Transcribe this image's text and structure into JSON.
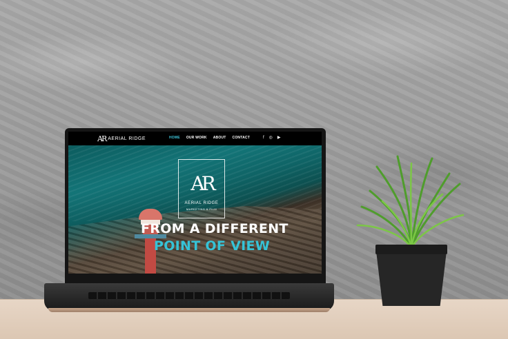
{
  "site": {
    "logo_mark": "AR",
    "logo_text": "AERIAL RIDGE",
    "nav": [
      {
        "label": "HOME",
        "active": true
      },
      {
        "label": "OUR WORK",
        "active": false
      },
      {
        "label": "ABOUT",
        "active": false
      },
      {
        "label": "CONTACT",
        "active": false
      }
    ],
    "social": [
      {
        "icon": "facebook-icon",
        "glyph": "f"
      },
      {
        "icon": "instagram-icon",
        "glyph": "◎"
      },
      {
        "icon": "youtube-icon",
        "glyph": "▶"
      }
    ],
    "emblem": {
      "mark": "AR",
      "title": "AERIAL RIDGE",
      "subtitle": "MARKETING & FILM"
    },
    "headline_line1": "FROM A DIFFERENT",
    "headline_line2": "POINT OF VIEW"
  },
  "colors": {
    "accent": "#35c3d7",
    "nav_background": "#000000"
  }
}
